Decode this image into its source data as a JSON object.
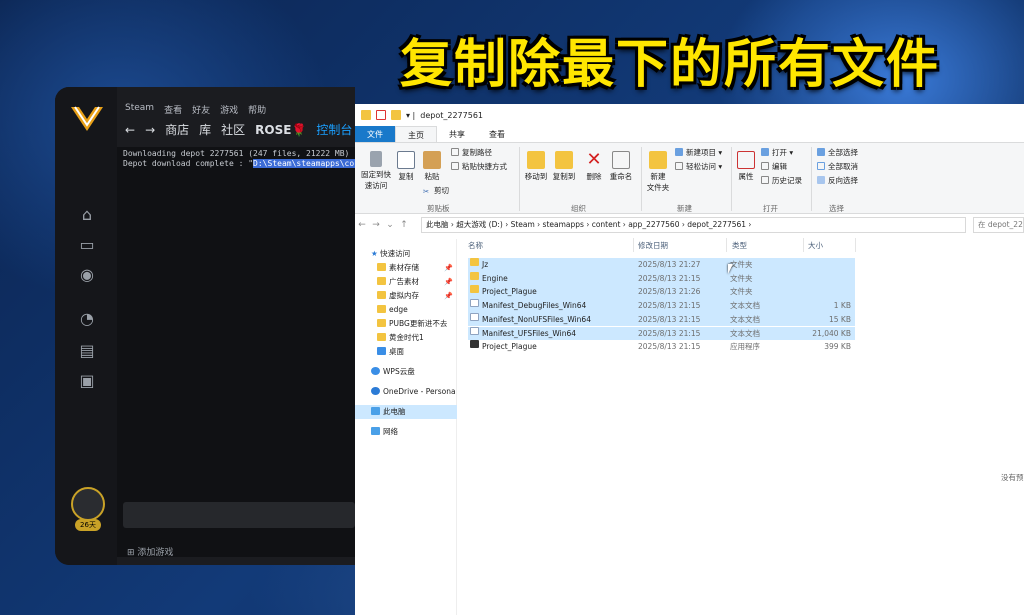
{
  "caption": "复制除最下的所有文件",
  "launcher": {
    "nav_icons": [
      "home-icon",
      "monitor-icon",
      "gamepad-icon",
      "speedometer-icon",
      "folder-icon",
      "gift-icon"
    ],
    "avatar_badge": "26天",
    "steam_menu": [
      "Steam",
      "查看",
      "好友",
      "游戏",
      "帮助"
    ],
    "steam_nav": [
      "←",
      "→",
      "商店",
      "库",
      "社区",
      "ROSE🌹",
      "控制台"
    ],
    "console_lines": [
      "Downloading depot 2277561 (247 files, 21222 MB) ...",
      "Depot download complete : \"",
      "D:\\Steam\\steamapps\\cont"
    ],
    "add_game": "添加游戏"
  },
  "explorer": {
    "title": "depot_2277561",
    "tabs": [
      "文件",
      "主页",
      "共享",
      "查看"
    ],
    "ribbon": {
      "pin": "固定到快\n速访问",
      "copy": "复制",
      "paste": "粘贴",
      "copy_path": "复制路径",
      "paste_shortcut": "粘贴快捷方式",
      "cut": "剪切",
      "clipboard": "剪贴板",
      "move_to": "移动到",
      "copy_to": "复制到",
      "delete": "删除",
      "rename": "重命名",
      "organize": "组织",
      "new_folder": "新建\n文件夹",
      "new_item": "新建项目 ▾",
      "easy_access": "轻松访问 ▾",
      "new": "新建",
      "properties": "属性",
      "open": "打开 ▾",
      "edit": "编辑",
      "history": "历史记录",
      "open_group": "打开",
      "select_all": "全部选择",
      "select_none": "全部取消",
      "invert": "反向选择",
      "select": "选择"
    },
    "address": "此电脑  ›  超大游戏 (D:)  ›  Steam  ›  steamapps  ›  content  ›  app_2277560  ›  depot_2277561  ›",
    "search_placeholder": "在 depot_22",
    "nav_items": [
      {
        "label": "快速访问",
        "pin": ""
      },
      {
        "label": "素材存储",
        "pin": "📌"
      },
      {
        "label": "广告素材",
        "pin": "📌"
      },
      {
        "label": "虚拟内存",
        "pin": "📌"
      },
      {
        "label": "edge",
        "pin": ""
      },
      {
        "label": "PUBG更新进不去",
        "pin": ""
      },
      {
        "label": "黄金时代1",
        "pin": ""
      },
      {
        "label": "桌面",
        "pin": ""
      },
      {
        "label": "WPS云盘",
        "pin": ""
      },
      {
        "label": "OneDrive - Persona",
        "pin": ""
      },
      {
        "label": "此电脑",
        "pin": ""
      },
      {
        "label": "网络",
        "pin": ""
      }
    ],
    "columns": [
      "名称",
      "修改日期",
      "类型",
      "大小"
    ],
    "files": [
      {
        "name": "Jz",
        "date": "2025/8/13 21:27",
        "type": "文件夹",
        "size": "",
        "icon": "folder",
        "selected": true
      },
      {
        "name": "Engine",
        "date": "2025/8/13 21:15",
        "type": "文件夹",
        "size": "",
        "icon": "folder",
        "selected": true
      },
      {
        "name": "Project_Plague",
        "date": "2025/8/13 21:26",
        "type": "文件夹",
        "size": "",
        "icon": "folder",
        "selected": true
      },
      {
        "name": "Manifest_DebugFiles_Win64",
        "date": "2025/8/13 21:15",
        "type": "文本文档",
        "size": "1 KB",
        "icon": "txt",
        "selected": true
      },
      {
        "name": "Manifest_NonUFSFiles_Win64",
        "date": "2025/8/13 21:15",
        "type": "文本文档",
        "size": "15 KB",
        "icon": "txt",
        "selected": true
      },
      {
        "name": "Manifest_UFSFiles_Win64",
        "date": "2025/8/13 21:15",
        "type": "文本文档",
        "size": "21,040 KB",
        "icon": "txt",
        "selected": true
      },
      {
        "name": "Project_Plague",
        "date": "2025/8/13 21:15",
        "type": "应用程序",
        "size": "399 KB",
        "icon": "exe",
        "selected": false
      }
    ],
    "no_preview": "没有预"
  }
}
